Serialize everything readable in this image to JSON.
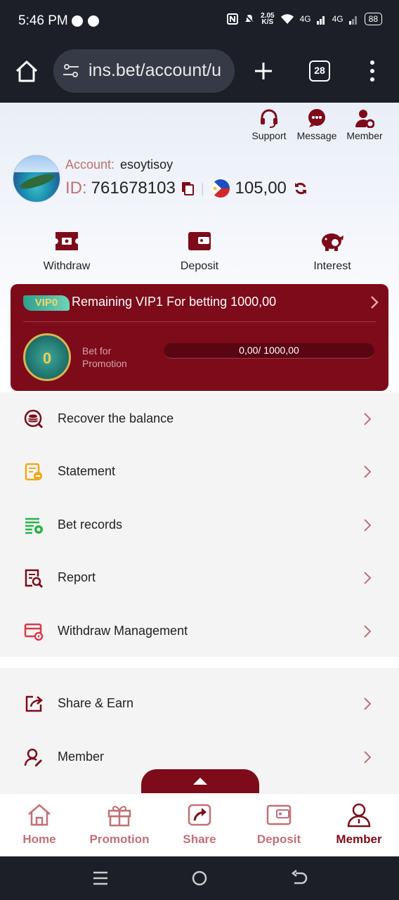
{
  "status_bar": {
    "time": "5:46 PM",
    "net_speed_value": "2.05",
    "net_speed_unit": "K/S",
    "signal1": "4G",
    "signal2": "4G",
    "battery": "88"
  },
  "browser": {
    "url": "ins.bet/account/u",
    "tab_count": "28"
  },
  "header_actions": [
    {
      "label": "Support",
      "icon": "headset-icon"
    },
    {
      "label": "Message",
      "icon": "chat-icon"
    },
    {
      "label": "Member",
      "icon": "member-settings-icon"
    }
  ],
  "account": {
    "account_label": "Account:",
    "account_name": "esoytisoy",
    "id_label": "ID:",
    "id_value": "761678103",
    "balance": "105,00"
  },
  "quick_actions": [
    {
      "label": "Withdraw",
      "icon": "withdraw-ticket-icon"
    },
    {
      "label": "Deposit",
      "icon": "wallet-icon"
    },
    {
      "label": "Interest",
      "icon": "piggy-bank-icon"
    }
  ],
  "vip": {
    "level_badge": "VIP0",
    "remaining_text": "Remaining VIP1 For betting 1000,00",
    "coin_level": "0",
    "bet_label": "Bet for Promotion",
    "progress_text": "0,00/ 1000,00",
    "progress_fraction": 0
  },
  "menu_items": [
    {
      "label": "Recover the balance",
      "icon": "recover-balance-icon"
    },
    {
      "label": "Statement",
      "icon": "statement-icon"
    },
    {
      "label": "Bet records",
      "icon": "bet-records-icon"
    },
    {
      "label": "Report",
      "icon": "report-icon"
    },
    {
      "label": "Withdraw Management",
      "icon": "withdraw-management-icon"
    }
  ],
  "menu_items_2": [
    {
      "label": "Share & Earn",
      "icon": "share-earn-icon"
    },
    {
      "label": "Member",
      "icon": "member-icon"
    }
  ],
  "bottom_nav": [
    {
      "label": "Home",
      "icon": "home-icon"
    },
    {
      "label": "Promotion",
      "icon": "gift-icon"
    },
    {
      "label": "Share",
      "icon": "share-icon"
    },
    {
      "label": "Deposit",
      "icon": "deposit-wallet-icon"
    },
    {
      "label": "Member",
      "icon": "member-person-icon",
      "active": true
    }
  ],
  "colors": {
    "brand": "#7d0b1a",
    "accent_text": "#c07070",
    "vip_progress": "#f3c642"
  }
}
